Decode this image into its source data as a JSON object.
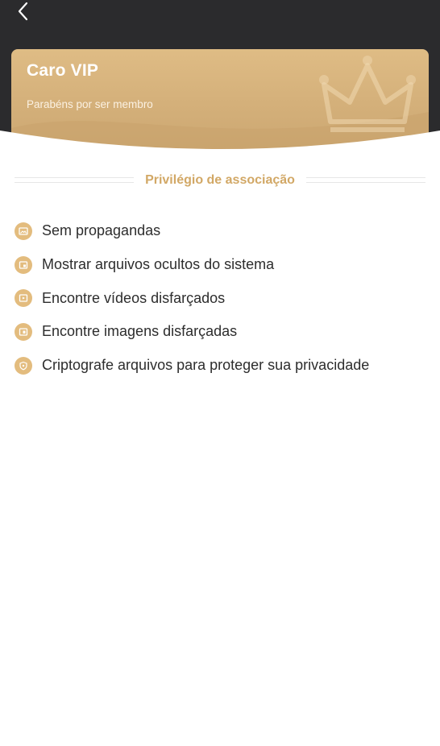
{
  "header": {
    "back_icon": "chevron-left-icon",
    "background_color": "#2b2b2d"
  },
  "vip_card": {
    "title": "Caro VIP",
    "subtitle": "Parabéns por ser membro",
    "decoration_icon": "crown-icon",
    "accent_color": "#d4b07a"
  },
  "section": {
    "title": "Privilégio de associação",
    "title_color": "#d2a866"
  },
  "features": [
    {
      "label": "Sem propagandas",
      "icon": "image-icon"
    },
    {
      "label": "Mostrar arquivos ocultos do sistema",
      "icon": "file-icon"
    },
    {
      "label": "Encontre vídeos disfarçados",
      "icon": "video-icon"
    },
    {
      "label": "Encontre imagens disfarçadas",
      "icon": "picture-icon"
    },
    {
      "label": "Criptografe arquivos para proteger sua privacidade",
      "icon": "shield-icon"
    }
  ]
}
